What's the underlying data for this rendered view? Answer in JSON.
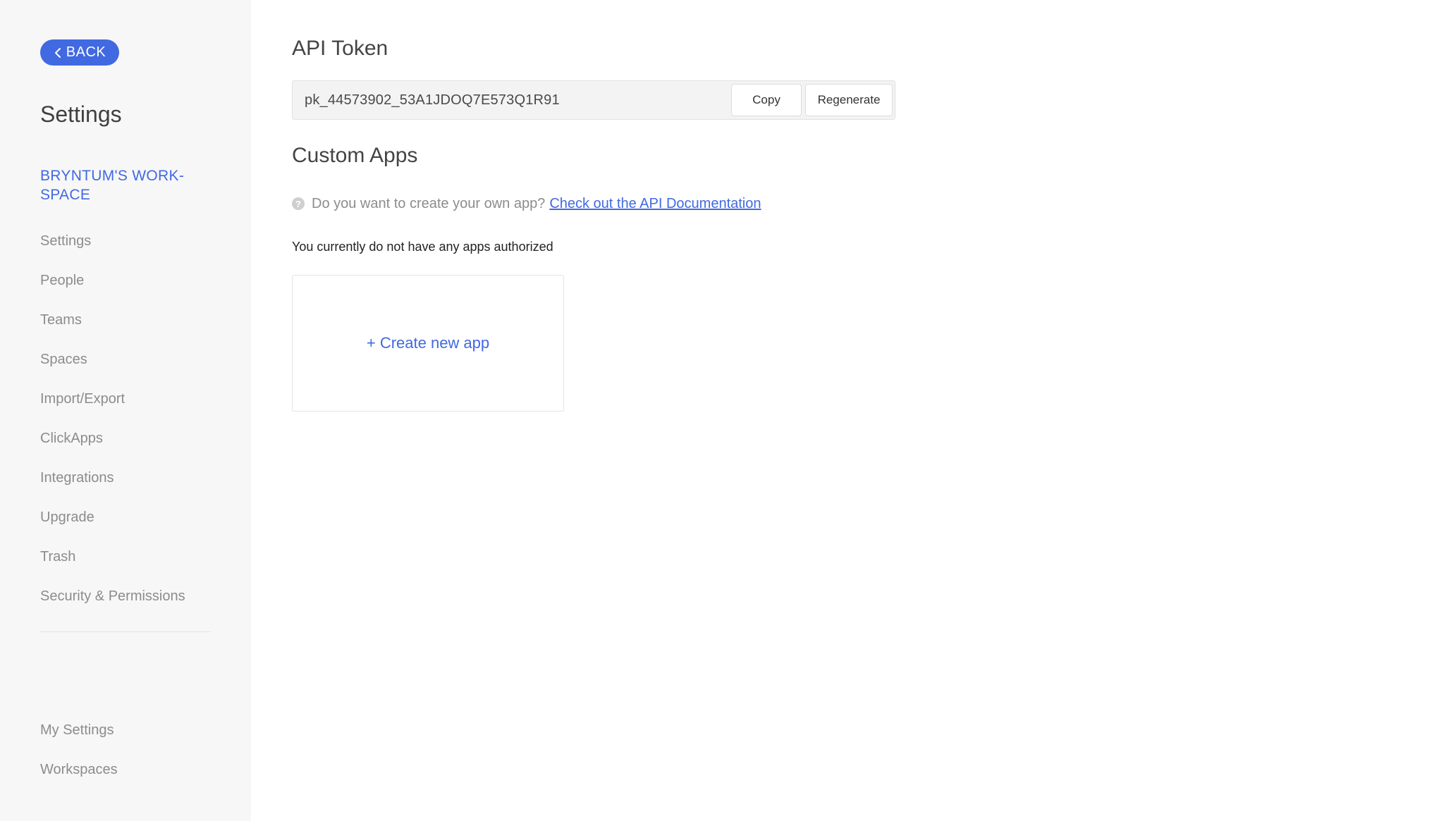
{
  "sidebar": {
    "back_label": "BACK",
    "title": "Settings",
    "workspace_name": "BRYNTUM'S WORK- SPACE",
    "items": [
      {
        "label": "Settings"
      },
      {
        "label": "People"
      },
      {
        "label": "Teams"
      },
      {
        "label": "Spaces"
      },
      {
        "label": "Import/Export"
      },
      {
        "label": "ClickApps"
      },
      {
        "label": "Integrations"
      },
      {
        "label": "Upgrade"
      },
      {
        "label": "Trash"
      },
      {
        "label": "Security & Permissions"
      }
    ],
    "bottom_items": [
      {
        "label": "My Settings"
      },
      {
        "label": "Workspaces"
      }
    ]
  },
  "main": {
    "api_token": {
      "title": "API Token",
      "value": "pk_44573902_53A1JDOQ7E573Q1R91",
      "copy_label": "Copy",
      "regenerate_label": "Regenerate"
    },
    "custom_apps": {
      "title": "Custom Apps",
      "help_text": "Do you want to create your own app?",
      "help_link": "Check out the API Documentation",
      "empty_text": "You currently do not have any apps authorized",
      "create_label": "+ Create new app"
    }
  },
  "colors": {
    "accent": "#4169e1",
    "sidebar_bg": "#f7f7f7",
    "muted_text": "#8c8c8c"
  },
  "icons": {
    "back": "chevron-left-icon",
    "help": "question-circle-icon"
  }
}
